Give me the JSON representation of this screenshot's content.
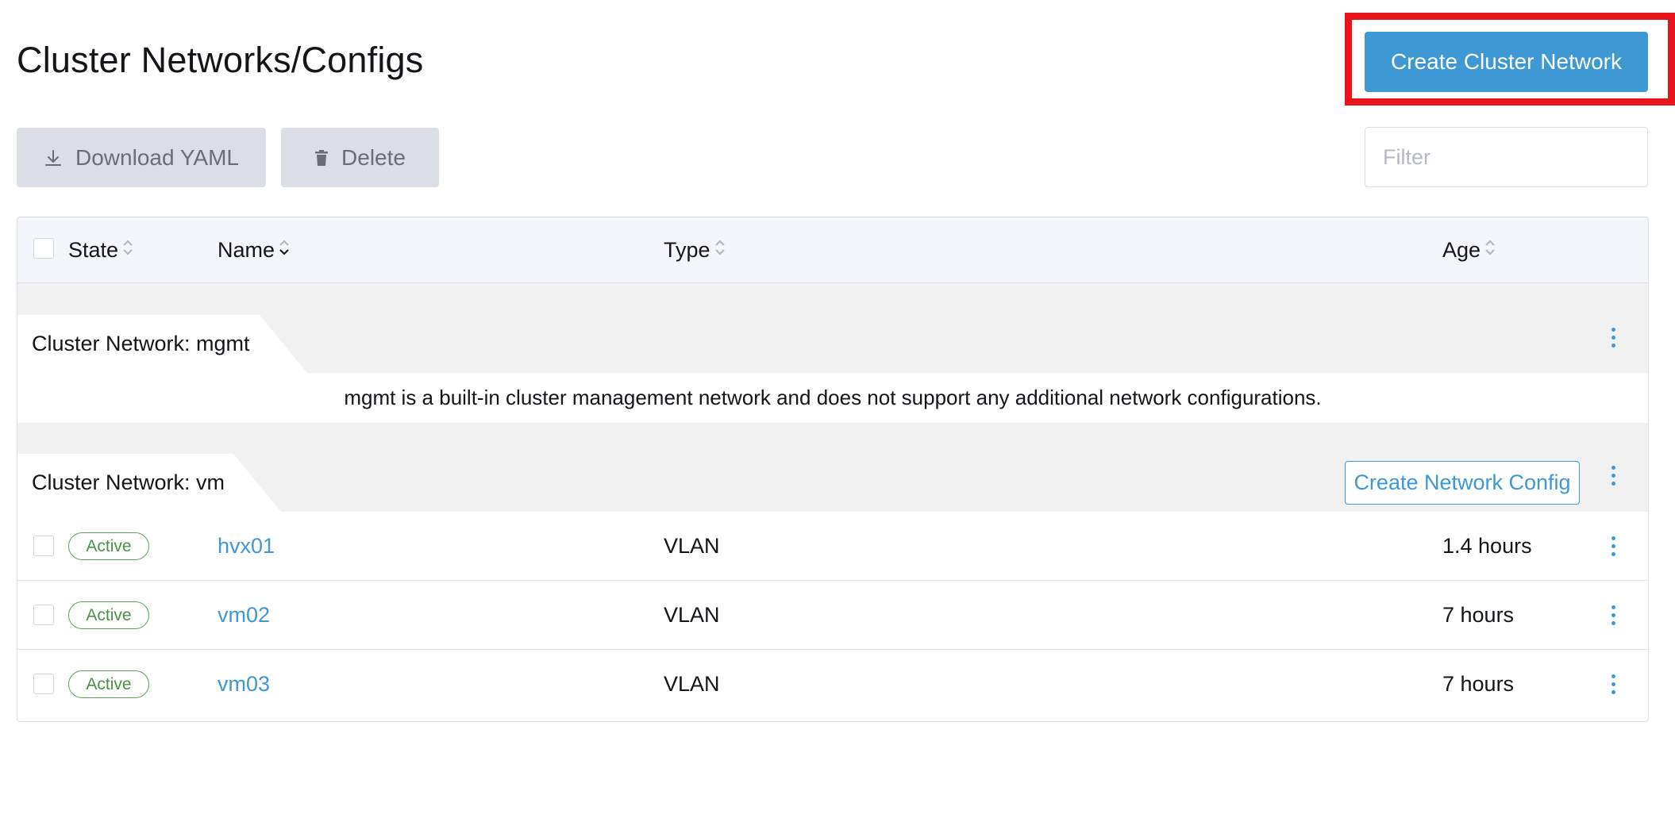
{
  "header": {
    "title": "Cluster Networks/Configs",
    "create_button": "Create Cluster Network"
  },
  "toolbar": {
    "download_label": "Download YAML",
    "delete_label": "Delete",
    "filter_placeholder": "Filter"
  },
  "table": {
    "columns": {
      "state": "State",
      "name": "Name",
      "type": "Type",
      "age": "Age"
    },
    "groups": [
      {
        "label": "Cluster Network: mgmt",
        "info": "mgmt is a built-in cluster management network and does not support any additional network configurations."
      },
      {
        "label": "Cluster Network: vm",
        "create_config_button": "Create Network Config",
        "rows": [
          {
            "state": "Active",
            "name": "hvx01",
            "type": "VLAN",
            "age": "1.4 hours"
          },
          {
            "state": "Active",
            "name": "vm02",
            "type": "VLAN",
            "age": "7 hours"
          },
          {
            "state": "Active",
            "name": "vm03",
            "type": "VLAN",
            "age": "7 hours"
          }
        ]
      }
    ]
  },
  "colors": {
    "accent": "#3d98d3",
    "highlight": "#e8141b",
    "active": "#4a8f4a"
  },
  "icons": [
    "download-icon",
    "trash-icon",
    "sort-icon",
    "kebab-menu-icon"
  ]
}
